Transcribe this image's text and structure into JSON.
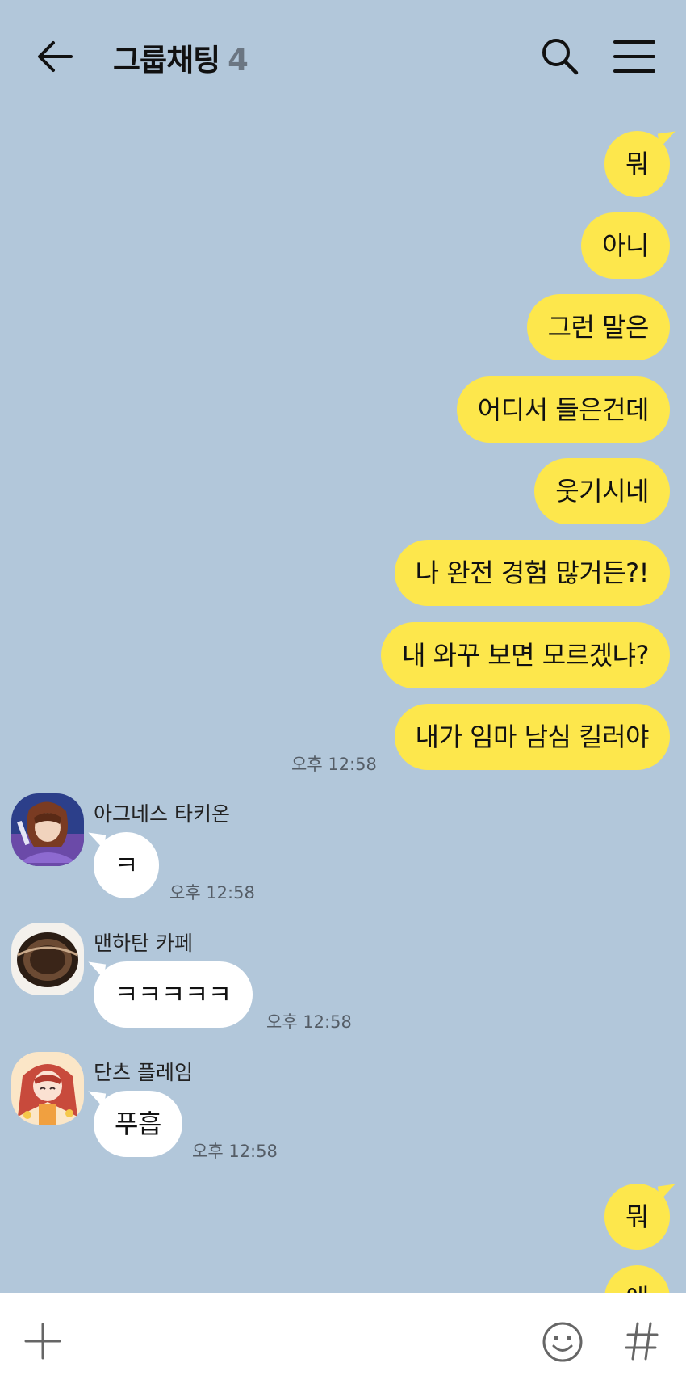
{
  "header": {
    "title": "그룹채팅",
    "member_count": "4",
    "back_icon": "arrow-left-icon",
    "search_icon": "search-icon",
    "menu_icon": "hamburger-menu-icon"
  },
  "messages": {
    "mine": [
      {
        "text": "뭐"
      },
      {
        "text": "아니"
      },
      {
        "text": "그런 말은"
      },
      {
        "text": "어디서 들은건데"
      },
      {
        "text": "웃기시네"
      },
      {
        "text": "나 완전 경험 많거든?!"
      },
      {
        "text": "내 와꾸 보면 모르겠냐?"
      },
      {
        "text": "내가 임마 남심 킬러야"
      }
    ],
    "mine_time": "오후 12:58",
    "others": [
      {
        "sender": "아그네스 타키온",
        "text": "ㅋ",
        "time": "오후 12:58"
      },
      {
        "sender": "맨하탄 카페",
        "text": "ㅋㅋㅋㅋㅋ",
        "time": "오후 12:58"
      },
      {
        "sender": "단츠 플레임",
        "text": "푸흡",
        "time": "오후 12:58"
      }
    ],
    "mine_after": [
      {
        "text": "뭐"
      },
      {
        "text": "애"
      }
    ]
  },
  "footer": {
    "plus_icon": "plus-icon",
    "emoji_icon": "emoji-icon",
    "hash_icon": "hash-icon"
  },
  "colors": {
    "background": "#b2c7da",
    "my_bubble": "#fde74c",
    "other_bubble": "#ffffff"
  }
}
